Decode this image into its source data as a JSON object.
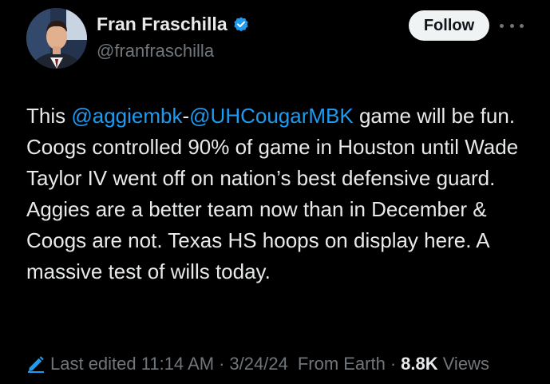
{
  "author": {
    "display_name": "Fran Fraschilla",
    "handle": "@franfraschilla",
    "verified": true
  },
  "follow_label": "Follow",
  "tweet": {
    "prefix": "This ",
    "mention1": "@aggiembk",
    "joiner": "-",
    "mention2": "@UHCougarMBK",
    "body": " game will be fun. Coogs controlled 90% of game in Houston until Wade Taylor IV went off on nation’s best defensive guard. Aggies are a better team now than in December & Coogs are not. Texas HS hoops on display here. A massive test of wills today."
  },
  "meta": {
    "last_edited": "Last edited 11:14 AM",
    "separator": "·",
    "date": "3/24/24",
    "source": "From Earth",
    "views_count": "8.8K",
    "views_label": "Views"
  },
  "colors": {
    "background": "#000000",
    "text": "#e7e9ea",
    "secondary": "#71767b",
    "link": "#1d9bf0",
    "verified": "#1d9bf0"
  },
  "icons": {
    "verified": "verified-badge-icon",
    "more": "more-horizontal-icon",
    "edit": "pencil-icon"
  }
}
